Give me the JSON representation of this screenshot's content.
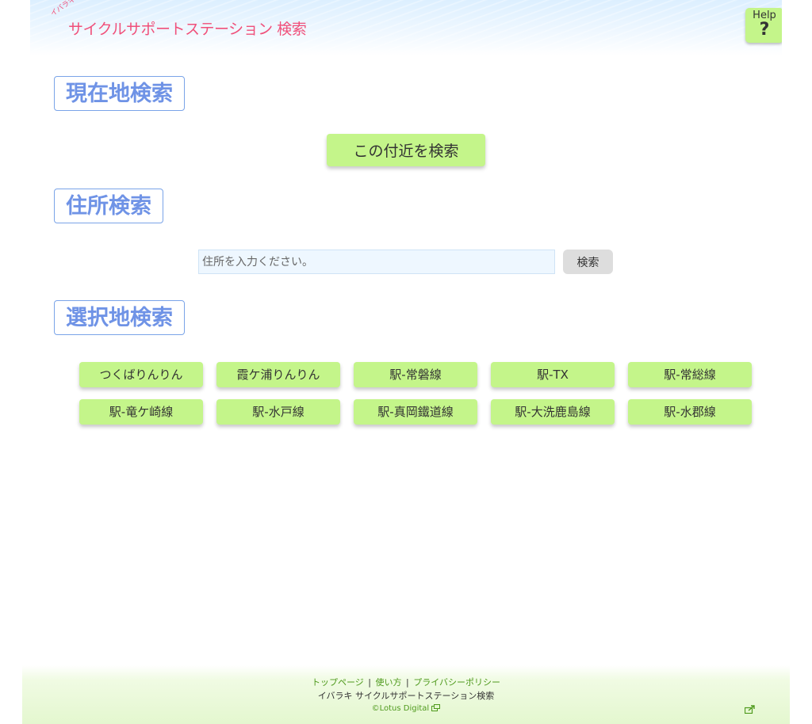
{
  "header": {
    "logo_ruby": "イバラキ",
    "logo_text": "サイクルサポートステーション 検索",
    "help_label": "Help",
    "help_symbol": "?"
  },
  "sections": {
    "current_location": {
      "title": "現在地検索",
      "button_label": "この付近を検索"
    },
    "address": {
      "title": "住所検索",
      "input_placeholder": "住所を入力ください。",
      "input_value": "",
      "search_label": "検索"
    },
    "selected_area": {
      "title": "選択地検索",
      "areas": [
        "つくばりんりん",
        "霞ケ浦りんりん",
        "駅-常磐線",
        "駅-TX",
        "駅-常総線",
        "駅-竜ケ崎線",
        "駅-水戸線",
        "駅-真岡鐵道線",
        "駅-大洗鹿島線",
        "駅-水郡線"
      ]
    }
  },
  "footer": {
    "links": [
      "トップページ",
      "使い方",
      "プライバシーポリシー"
    ],
    "separator": "|",
    "site_name": "イバラキ サイクルサポートステーション検索",
    "copyright": "©Lotus Digital"
  },
  "colors": {
    "accent_pink": "#f0507a",
    "heading_blue": "#6f93e6",
    "button_green": "#c4f58a",
    "link_green": "#4f9a1d"
  },
  "icons": {
    "help": "question-mark-icon",
    "external": "external-window-icon",
    "share": "share-icon"
  }
}
